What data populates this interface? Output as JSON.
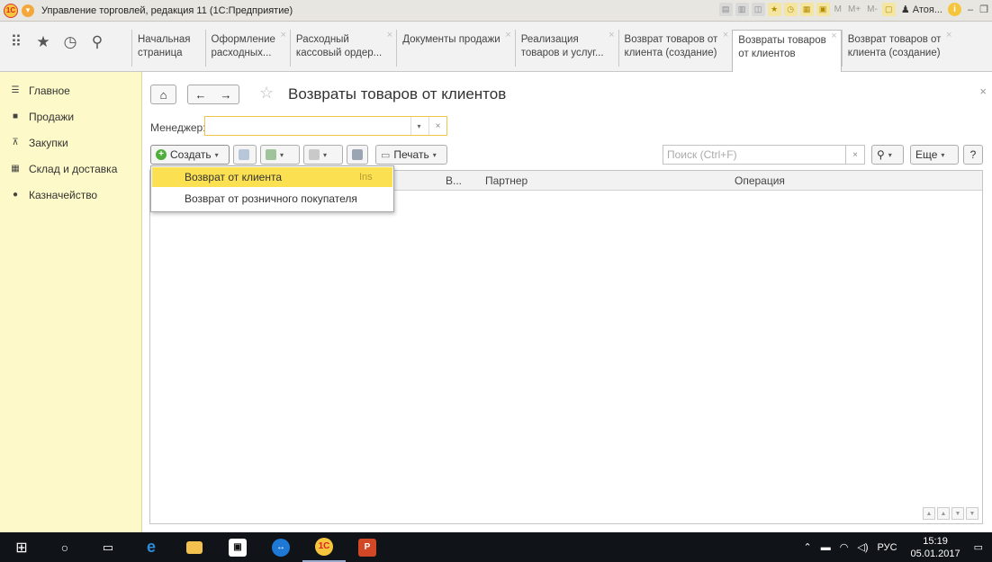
{
  "window": {
    "title": "Управление торговлей, редакция 11 (1С:Предприятие)",
    "user": "Атоя...",
    "toolbar_text": [
      "M",
      "M+",
      "M-"
    ]
  },
  "tabs": [
    {
      "label": "Начальная\nстраница",
      "closable": false,
      "active": false
    },
    {
      "label": "Оформление\nрасходных...",
      "closable": true,
      "active": false
    },
    {
      "label": "Расходный\nкассовый ордер...",
      "closable": true,
      "active": false
    },
    {
      "label": "Документы продажи",
      "closable": true,
      "active": false
    },
    {
      "label": "Реализация\nтоваров и услуг...",
      "closable": true,
      "active": false
    },
    {
      "label": "Возврат товаров от\nклиента (создание)",
      "closable": true,
      "active": false
    },
    {
      "label": "Возвраты товаров\nот клиентов",
      "closable": true,
      "active": true
    },
    {
      "label": "Возврат товаров от\nклиента (создание)",
      "closable": true,
      "active": false
    }
  ],
  "sidebar": {
    "items": [
      {
        "label": "Главное",
        "icon": "menu-lines-icon"
      },
      {
        "label": "Продажи",
        "icon": "bag-icon"
      },
      {
        "label": "Закупки",
        "icon": "cart-icon"
      },
      {
        "label": "Склад и доставка",
        "icon": "grid-icon"
      },
      {
        "label": "Казначейство",
        "icon": "coin-icon"
      }
    ]
  },
  "page": {
    "title": "Возвраты товаров от клиентов",
    "manager_label": "Менеджер:",
    "manager_value": ""
  },
  "commands": {
    "create": "Создать",
    "print": "Печать",
    "more": "Еще",
    "help": "?",
    "search_placeholder": "Поиск (Ctrl+F)"
  },
  "table": {
    "columns": [
      "В...",
      "Партнер",
      "Операция"
    ]
  },
  "create_menu": {
    "items": [
      {
        "label": "Возврат от клиента",
        "shortcut": "Ins"
      },
      {
        "label": "Возврат от розничного покупателя",
        "shortcut": ""
      }
    ]
  },
  "taskbar": {
    "language": "РУС",
    "time": "15:19",
    "date": "05.01.2017"
  },
  "colors": {
    "sidebar_bg": "#fdf9c8",
    "highlight": "#fbe052",
    "accent_green": "#4fae3a"
  }
}
